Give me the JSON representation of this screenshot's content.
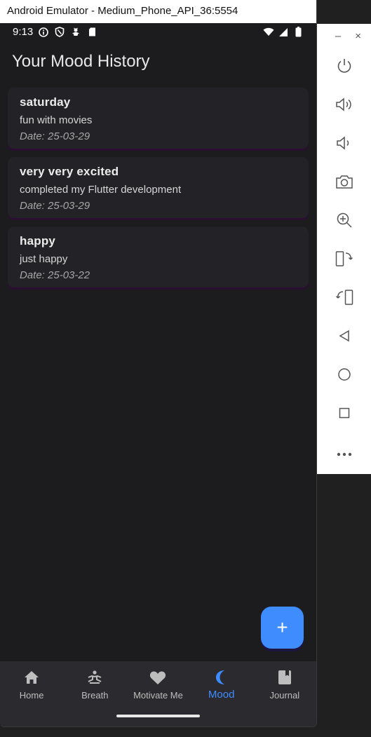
{
  "window": {
    "title": "Android Emulator - Medium_Phone_API_36:5554"
  },
  "status_bar": {
    "time": "9:13"
  },
  "app": {
    "title": "Your Mood History"
  },
  "moods": [
    {
      "title": "saturday",
      "description": "fun with movies",
      "date": "Date: 25-03-29"
    },
    {
      "title": "very very excited",
      "description": "completed my Flutter development",
      "date": "Date: 25-03-29"
    },
    {
      "title": "happy",
      "description": "just happy",
      "date": "Date: 25-03-22"
    }
  ],
  "fab": {
    "label": "+"
  },
  "nav": [
    {
      "label": "Home",
      "icon": "home-icon"
    },
    {
      "label": "Breath",
      "icon": "meditation-icon"
    },
    {
      "label": "Motivate Me",
      "icon": "heart-icon"
    },
    {
      "label": "Mood",
      "icon": "moon-icon",
      "active": true
    },
    {
      "label": "Journal",
      "icon": "journal-icon"
    }
  ],
  "side_toolbar": {
    "minimize_label": "–",
    "close_label": "×",
    "tools": [
      "power-icon",
      "volume-up-icon",
      "volume-down-icon",
      "camera-icon",
      "zoom-icon",
      "rotate-left-icon",
      "rotate-right-icon",
      "back-icon",
      "home-circle-icon",
      "overview-icon",
      "more-icon"
    ]
  },
  "colors": {
    "accent": "#3f8cff",
    "card": "#232227",
    "background": "#1c1c1e",
    "nav": "#2b2b2f"
  }
}
